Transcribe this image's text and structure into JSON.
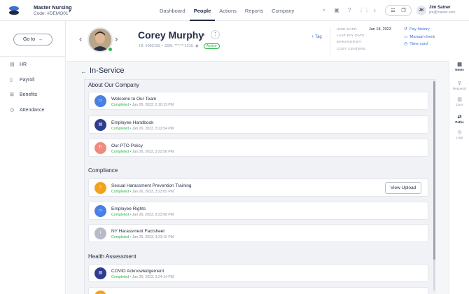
{
  "header": {
    "org_name": "Master Nursing",
    "org_code": "Code: #DEMO01",
    "nav": [
      {
        "label": "Dashboard",
        "active": false
      },
      {
        "label": "People",
        "active": true
      },
      {
        "label": "Actions",
        "active": false
      },
      {
        "label": "Reports",
        "active": false
      },
      {
        "label": "Company",
        "active": false
      }
    ],
    "icons": [
      "search-icon",
      "calendar-icon",
      "help-icon",
      "apps-icon",
      "bell-icon"
    ],
    "user_initials": "JK",
    "user_name": "Jim Satner",
    "user_email": "jim@master.com"
  },
  "sidebar": {
    "goto_label": "Go to",
    "items": [
      {
        "label": "HR",
        "icon": "id-card-icon"
      },
      {
        "label": "Payroll",
        "icon": "document-icon"
      },
      {
        "label": "Benefits",
        "icon": "gift-icon"
      },
      {
        "label": "Attendance",
        "icon": "clock-icon"
      }
    ]
  },
  "employee": {
    "name": "Corey Murphy",
    "id_text": "ID: #992193",
    "ssn_text": "SSN: ***-**-1215",
    "status": "Active",
    "tag_label": "+ Tag",
    "info": [
      {
        "label": "HIRE DATE:",
        "value": "Jan 18, 2023"
      },
      {
        "label": "LAST PAY DATE:",
        "value": ""
      },
      {
        "label": "MANAGED BY:",
        "value": ""
      },
      {
        "label": "COST CENTERS:",
        "value": ""
      }
    ],
    "links": [
      {
        "label": "Pay history",
        "icon": "history-icon"
      },
      {
        "label": "Manual check",
        "icon": "check-icon"
      },
      {
        "label": "Time card",
        "icon": "time-card-icon"
      }
    ]
  },
  "rightrail": {
    "items": [
      {
        "label": "Notes",
        "active": true
      },
      {
        "label": "Requests",
        "active": false
      },
      {
        "label": "Docs",
        "active": false
      },
      {
        "label": "Paths",
        "active": true
      },
      {
        "label": "Logs",
        "active": false
      }
    ]
  },
  "main": {
    "title": "In-Service",
    "sections": [
      {
        "title": "About Our Company",
        "items": [
          {
            "title": "Welcome to Our Team",
            "status": "Completed",
            "date": "• Jan 26, 2023, 2:10:19 PM",
            "icon": "video-icon",
            "color": "#4a7fe3"
          },
          {
            "title": "Employee Handbook",
            "status": "Completed",
            "date": "• Jan 26, 2023, 3:22:54 PM",
            "icon": "document-icon",
            "color": "#2f3d8f"
          },
          {
            "title": "Our PTO Policy",
            "status": "Completed",
            "date": "• Jan 26, 2023, 3:22:56 PM",
            "icon": "text-icon",
            "color": "#ee8b80"
          }
        ]
      },
      {
        "title": "Compliance",
        "items": [
          {
            "title": "Sexual Harassment Prevention Training",
            "status": "Completed",
            "date": "• Jan 26, 2023, 3:23:05 PM",
            "icon": "upload-icon",
            "color": "#f2a21b",
            "button": "View Upload"
          },
          {
            "title": "Employee Rights",
            "status": "Completed",
            "date": "• Jan 26, 2023, 3:23:08 PM",
            "icon": "video-icon",
            "color": "#4a7fe3"
          },
          {
            "title": "NY Harassment Factsheet",
            "status": "Completed",
            "date": "• Jan 26, 2023, 3:23:10 PM",
            "icon": "attachment-icon",
            "color": "#b7bcc8"
          }
        ]
      },
      {
        "title": "Health Assessment",
        "items": [
          {
            "title": "COVID Acknowledgement",
            "status": "Completed",
            "date": "• Jan 26, 2023, 3:24:14 PM",
            "icon": "document-icon",
            "color": "#2f3d8f"
          }
        ]
      }
    ]
  }
}
